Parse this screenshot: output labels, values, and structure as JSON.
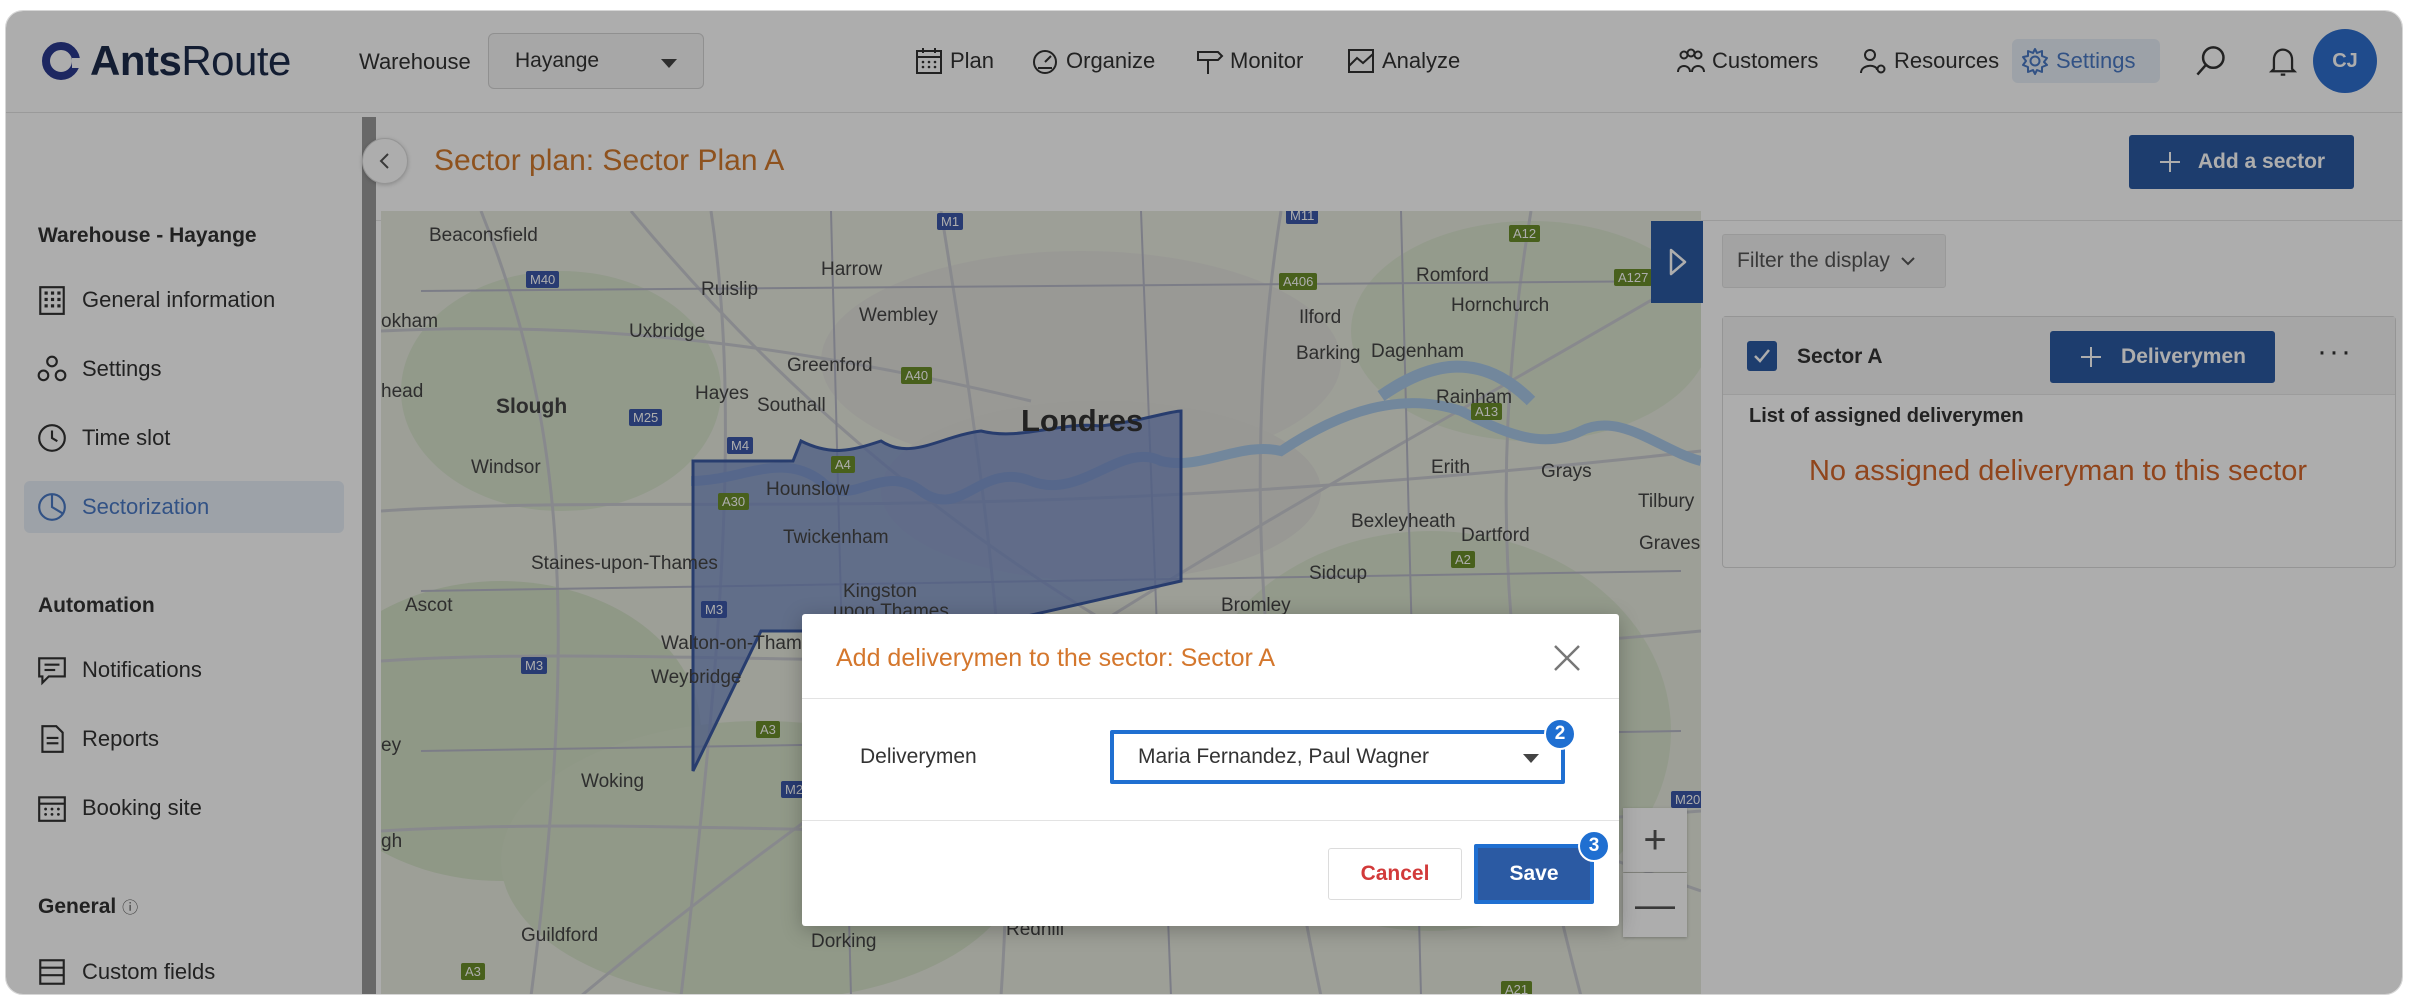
{
  "app": {
    "logo_ants": "Ants",
    "logo_route": "Route",
    "warehouse_label": "Warehouse",
    "warehouse_value": "Hayange",
    "avatar_initials": "CJ"
  },
  "nav": {
    "plan": "Plan",
    "organize": "Organize",
    "monitor": "Monitor",
    "analyze": "Analyze",
    "customers": "Customers",
    "resources": "Resources",
    "settings": "Settings"
  },
  "sidebar": {
    "section_warehouse": "Warehouse - Hayange",
    "items_warehouse": [
      {
        "label": "General information",
        "icon": "building-icon"
      },
      {
        "label": "Settings",
        "icon": "settings-nodes-icon"
      },
      {
        "label": "Time slot",
        "icon": "clock-icon"
      },
      {
        "label": "Sectorization",
        "icon": "pie-icon"
      }
    ],
    "section_automation": "Automation",
    "items_automation": [
      {
        "label": "Notifications",
        "icon": "message-icon"
      },
      {
        "label": "Reports",
        "icon": "document-icon"
      },
      {
        "label": "Booking site",
        "icon": "calendar-icon"
      }
    ],
    "section_general": "General",
    "items_general": [
      {
        "label": "Custom fields",
        "icon": "list-icon"
      }
    ]
  },
  "page": {
    "title": "Sector plan: Sector Plan A",
    "add_sector_label": "Add a sector",
    "filter_label": "Filter the display"
  },
  "sector_card": {
    "name": "Sector A",
    "deliverymen_button": "Deliverymen",
    "more_label": "···",
    "assigned_title": "List of assigned deliverymen",
    "no_assigned": "No assigned deliveryman to this sector"
  },
  "map": {
    "labels": {
      "beaconsfield": "Beaconsfield",
      "ruislip": "Ruislip",
      "harrow": "Harrow",
      "romford": "Romford",
      "hornchurch": "Hornchurch",
      "ilford": "Ilford",
      "wembley": "Wembley",
      "uxbridge": "Uxbridge",
      "barking": "Barking",
      "dagenham": "Dagenham",
      "greenford": "Greenford",
      "hayes": "Hayes",
      "southall": "Southall",
      "slough": "Slough",
      "londres": "Londres",
      "rainham": "Rainham",
      "windsor": "Windsor",
      "hounslow": "Hounslow",
      "erith": "Erith",
      "grays": "Grays",
      "tilbury": "Tilbury",
      "twickenham": "Twickenham",
      "bexleyheath": "Bexleyheath",
      "dartford": "Dartford",
      "gravesend": "Gravese",
      "staines": "Staines-upon-Thames",
      "kingston": "Kingston",
      "upon_thames": "upon Thames",
      "sidcup": "Sidcup",
      "ascot": "Ascot",
      "bromley": "Bromley",
      "walton": "Walton-on-Tham",
      "weybridge": "Weybridge",
      "woking": "Woking",
      "guildford": "Guildford",
      "dorking": "Dorking",
      "redhill": "Redhill",
      "okham": "okham",
      "head": "head",
      "ey": "ey",
      "gh": "gh"
    },
    "roads": {
      "m1": "M1",
      "m40": "M40",
      "m25": "M25",
      "m4": "M4",
      "a30": "A30",
      "m3": "M3",
      "m3b": "M3",
      "a3": "A3",
      "a3b": "A3",
      "m2": "M2",
      "a40": "A40",
      "a406": "A406",
      "a4": "A4",
      "a12": "A12",
      "a127": "A127",
      "a13": "A13",
      "a2": "A2",
      "m20": "M20",
      "a21": "A21",
      "m11": "M11"
    }
  },
  "modal": {
    "title": "Add deliverymen to the sector: Sector A",
    "field_label": "Deliverymen",
    "field_value": "Maria Fernandez, Paul Wagner",
    "cancel_label": "Cancel",
    "save_label": "Save",
    "step_select": "2",
    "step_save": "3"
  },
  "colors": {
    "brand_blue": "#2b5aa3",
    "highlight_blue": "#1f6fd1",
    "title_orange": "#d17a2d",
    "sector_fill": "#6f87c4"
  }
}
